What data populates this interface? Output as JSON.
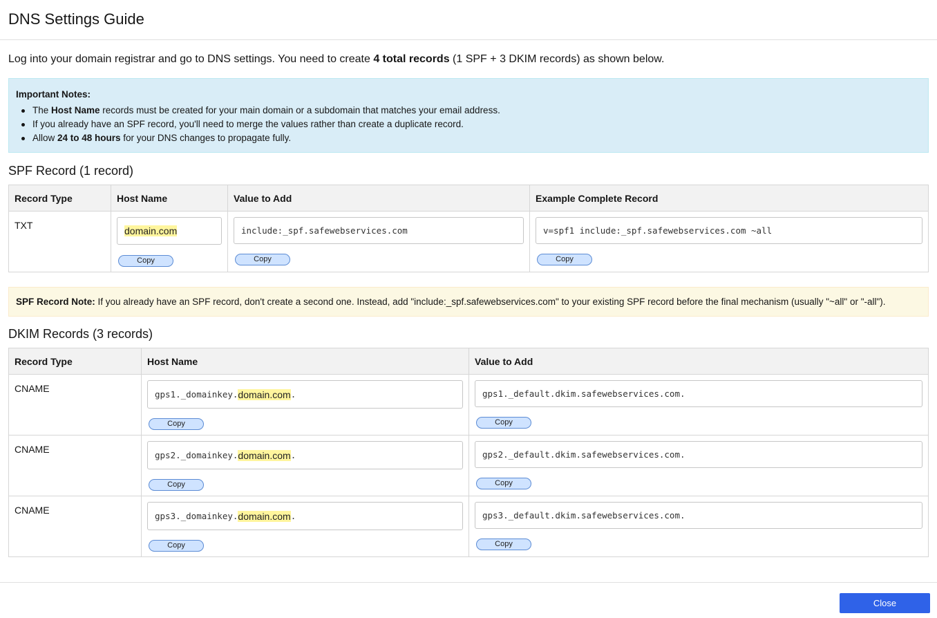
{
  "title": "DNS Settings Guide",
  "intro": {
    "before": "Log into your domain registrar and go to DNS settings. You need to create ",
    "bold": "4 total records",
    "after": " (1 SPF + 3 DKIM records) as shown below."
  },
  "notes": {
    "title": "Important Notes:",
    "item1": {
      "before": "The ",
      "bold": "Host Name",
      "after": " records must be created for your main domain or a subdomain that matches your email address."
    },
    "item2": {
      "text": "If you already have an SPF record, you'll need to merge the values rather than create a duplicate record."
    },
    "item3": {
      "before": "Allow ",
      "bold": "24 to 48 hours",
      "after": " for your DNS changes to propagate fully."
    }
  },
  "spf": {
    "section_title": "SPF Record (1 record)",
    "headers": [
      "Record Type",
      "Host Name",
      "Value to Add",
      "Example Complete Record"
    ],
    "row": {
      "type": "TXT",
      "host": "domain.com",
      "value": "include:_spf.safewebservices.com",
      "example": "v=spf1 include:_spf.safewebservices.com ~all"
    },
    "copy_label": "Copy"
  },
  "spf_note": {
    "bold": "SPF Record Note:",
    "text": " If you already have an SPF record, don't create a second one. Instead, add \"include:_spf.safewebservices.com\" to your existing SPF record before the final mechanism (usually \"~all\" or \"-all\")."
  },
  "dkim": {
    "section_title": "DKIM Records (3 records)",
    "headers": [
      "Record Type",
      "Host Name",
      "Value to Add"
    ],
    "rows": [
      {
        "type": "CNAME",
        "host_prefix": "gps1._domainkey.",
        "host_domain": "domain.com",
        "host_suffix": ".",
        "value": "gps1._default.dkim.safewebservices.com."
      },
      {
        "type": "CNAME",
        "host_prefix": "gps2._domainkey.",
        "host_domain": "domain.com",
        "host_suffix": ".",
        "value": "gps2._default.dkim.safewebservices.com."
      },
      {
        "type": "CNAME",
        "host_prefix": "gps3._domainkey.",
        "host_domain": "domain.com",
        "host_suffix": ".",
        "value": "gps3._default.dkim.safewebservices.com."
      }
    ],
    "copy_label": "Copy"
  },
  "footer": {
    "close_label": "Close"
  },
  "colors": {
    "info_bg": "#d9edf7",
    "warning_bg": "#fcf8e3",
    "highlight": "#fff59d",
    "copy_button_bg": "#cfe3ff",
    "primary_button": "#2f62e8"
  }
}
